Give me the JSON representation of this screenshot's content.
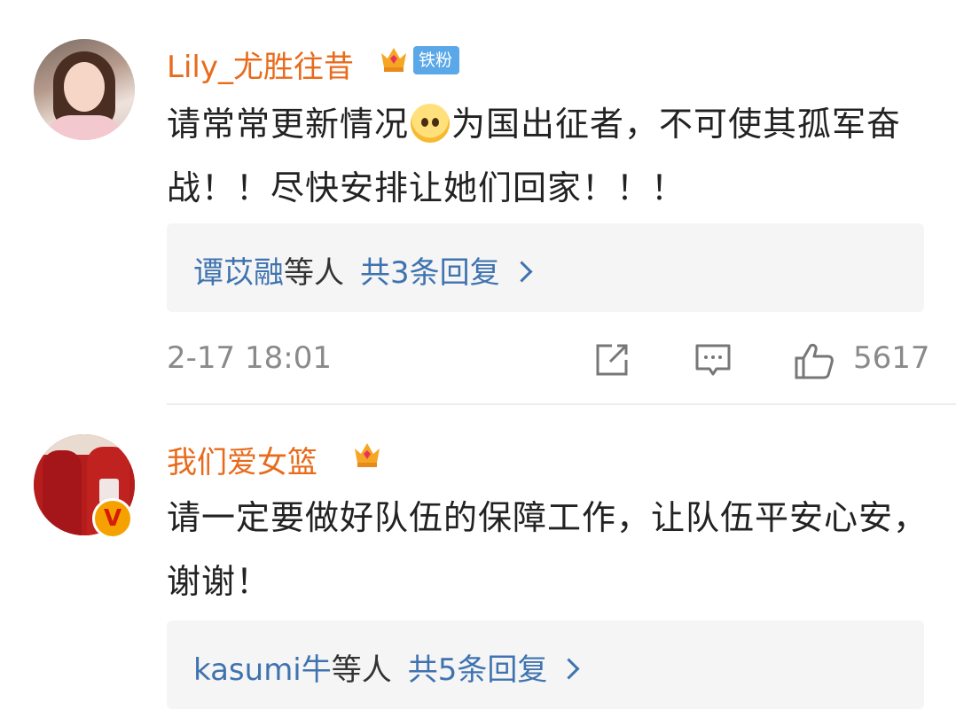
{
  "comments": [
    {
      "username": "Lily_尤胜往昔",
      "badge": "铁粉",
      "text_before_emoji": "请常常更新情况",
      "text_after_emoji": "为国出征者，不可使其孤军奋战！！尽快安排让她们回家！！！",
      "emoji": "pleading-face-icon",
      "reply_names": "谭苡融",
      "reply_suffix": "等人",
      "reply_count": "共3条回复",
      "time": "2-17 18:01",
      "likes": "5617"
    },
    {
      "username": "我们爱女篮",
      "verified": "V",
      "text": "请一定要做好队伍的保障工作，让队伍平安心安，谢谢！",
      "reply_names": "kasumi牛",
      "reply_suffix": "等人",
      "reply_count": "共5条回复"
    }
  ],
  "colors": {
    "username": "#e86b1c",
    "link": "#3f73b0",
    "muted": "#8a8a8a",
    "badge_bg": "#5aa8e8"
  },
  "icons": [
    "crown-icon",
    "share-icon",
    "comment-icon",
    "like-icon",
    "chevron-right-icon",
    "verified-icon"
  ]
}
